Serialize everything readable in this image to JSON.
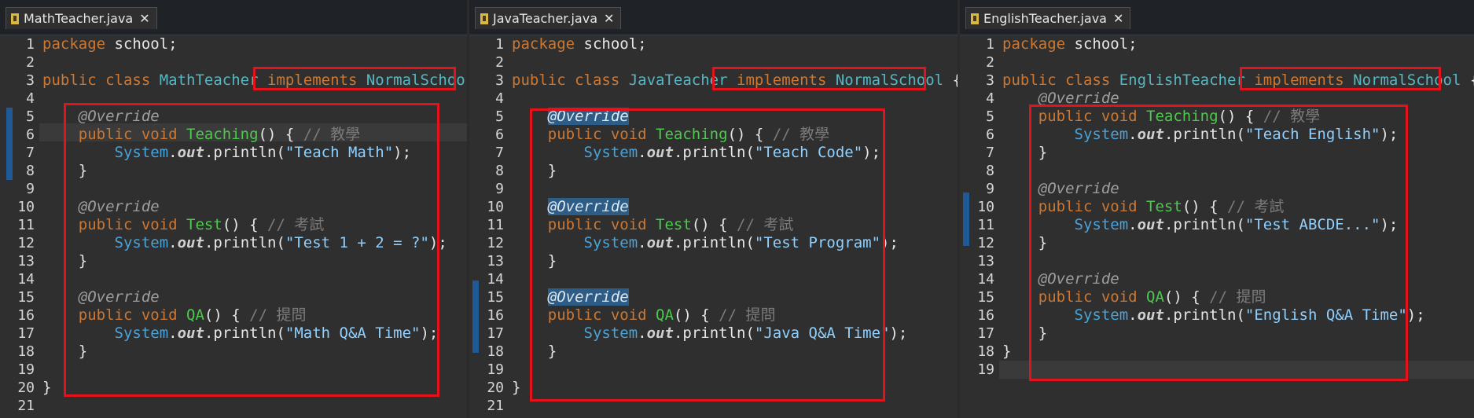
{
  "panels": [
    {
      "tab": "MathTeacher.java",
      "code": [
        {
          "n": "1",
          "s": [
            [
              "package",
              "kw"
            ],
            [
              " school;",
              ""
            ]
          ]
        },
        {
          "n": "2",
          "s": []
        },
        {
          "n": "3",
          "s": [
            [
              "public class ",
              "kw"
            ],
            [
              "MathTeacher",
              "cls"
            ],
            [
              " implements ",
              "kw"
            ],
            [
              "NormalSchoo",
              "cls"
            ]
          ]
        },
        {
          "n": "4",
          "s": []
        },
        {
          "n": "5",
          "s": [
            [
              "    ",
              ""
            ],
            [
              "@Override",
              "ann"
            ]
          ]
        },
        {
          "n": "6",
          "s": [
            [
              "    public void ",
              "kw"
            ],
            [
              "Teaching",
              "method"
            ],
            [
              "() { ",
              ""
            ],
            [
              "// 教學",
              "cmt"
            ]
          ]
        },
        {
          "n": "7",
          "s": [
            [
              "        ",
              ""
            ],
            [
              "System",
              "sys"
            ],
            [
              ".",
              ""
            ],
            [
              "out",
              "out"
            ],
            [
              ".println(",
              ""
            ],
            [
              "\"Teach Math\"",
              "str"
            ],
            [
              ");",
              ""
            ]
          ]
        },
        {
          "n": "8",
          "s": [
            [
              "    }",
              ""
            ]
          ]
        },
        {
          "n": "9",
          "s": []
        },
        {
          "n": "10",
          "s": [
            [
              "    ",
              ""
            ],
            [
              "@Override",
              "ann"
            ]
          ]
        },
        {
          "n": "11",
          "s": [
            [
              "    public void ",
              "kw"
            ],
            [
              "Test",
              "method"
            ],
            [
              "() { ",
              ""
            ],
            [
              "// 考試",
              "cmt"
            ]
          ]
        },
        {
          "n": "12",
          "s": [
            [
              "        ",
              ""
            ],
            [
              "System",
              "sys"
            ],
            [
              ".",
              ""
            ],
            [
              "out",
              "out"
            ],
            [
              ".println(",
              ""
            ],
            [
              "\"Test 1 + 2 = ?\"",
              "str"
            ],
            [
              ");",
              ""
            ]
          ]
        },
        {
          "n": "13",
          "s": [
            [
              "    }",
              ""
            ]
          ]
        },
        {
          "n": "14",
          "s": []
        },
        {
          "n": "15",
          "s": [
            [
              "    ",
              ""
            ],
            [
              "@Override",
              "ann"
            ]
          ]
        },
        {
          "n": "16",
          "s": [
            [
              "    public void ",
              "kw"
            ],
            [
              "QA",
              "method"
            ],
            [
              "() { ",
              ""
            ],
            [
              "// 提問",
              "cmt"
            ]
          ]
        },
        {
          "n": "17",
          "s": [
            [
              "        ",
              ""
            ],
            [
              "System",
              "sys"
            ],
            [
              ".",
              ""
            ],
            [
              "out",
              "out"
            ],
            [
              ".println(",
              ""
            ],
            [
              "\"Math Q&A Time\"",
              "str"
            ],
            [
              ");",
              ""
            ]
          ]
        },
        {
          "n": "18",
          "s": [
            [
              "    }",
              ""
            ]
          ]
        },
        {
          "n": "19",
          "s": []
        },
        {
          "n": "20",
          "s": [
            [
              "}",
              ""
            ]
          ]
        },
        {
          "n": "21",
          "s": []
        }
      ]
    },
    {
      "tab": "JavaTeacher.java",
      "code": [
        {
          "n": "1",
          "s": [
            [
              "package",
              "kw"
            ],
            [
              " school;",
              ""
            ]
          ]
        },
        {
          "n": "2",
          "s": []
        },
        {
          "n": "3",
          "s": [
            [
              "public class ",
              "kw"
            ],
            [
              "JavaTeacher",
              "cls"
            ],
            [
              " implements ",
              "kw"
            ],
            [
              "NormalSchool",
              "cls"
            ],
            [
              " {",
              ""
            ]
          ]
        },
        {
          "n": "4",
          "s": []
        },
        {
          "n": "5",
          "s": [
            [
              "    ",
              ""
            ],
            [
              "@Override",
              "ann hl"
            ]
          ]
        },
        {
          "n": "6",
          "s": [
            [
              "    public void ",
              "kw"
            ],
            [
              "Teaching",
              "method"
            ],
            [
              "() { ",
              ""
            ],
            [
              "// 教學",
              "cmt"
            ]
          ]
        },
        {
          "n": "7",
          "s": [
            [
              "        ",
              ""
            ],
            [
              "System",
              "sys"
            ],
            [
              ".",
              ""
            ],
            [
              "out",
              "out"
            ],
            [
              ".println(",
              ""
            ],
            [
              "\"Teach Code\"",
              "str"
            ],
            [
              ");",
              ""
            ]
          ]
        },
        {
          "n": "8",
          "s": [
            [
              "    }",
              ""
            ]
          ]
        },
        {
          "n": "9",
          "s": []
        },
        {
          "n": "10",
          "s": [
            [
              "    ",
              ""
            ],
            [
              "@Override",
              "ann hl"
            ]
          ]
        },
        {
          "n": "11",
          "s": [
            [
              "    public void ",
              "kw"
            ],
            [
              "Test",
              "method"
            ],
            [
              "() { ",
              ""
            ],
            [
              "// 考試",
              "cmt"
            ]
          ]
        },
        {
          "n": "12",
          "s": [
            [
              "        ",
              ""
            ],
            [
              "System",
              "sys"
            ],
            [
              ".",
              ""
            ],
            [
              "out",
              "out"
            ],
            [
              ".println(",
              ""
            ],
            [
              "\"Test Program\"",
              "str"
            ],
            [
              ");",
              ""
            ]
          ]
        },
        {
          "n": "13",
          "s": [
            [
              "    }",
              ""
            ]
          ]
        },
        {
          "n": "14",
          "s": []
        },
        {
          "n": "15",
          "s": [
            [
              "    ",
              ""
            ],
            [
              "@Override",
              "ann hl"
            ]
          ]
        },
        {
          "n": "16",
          "s": [
            [
              "    public void ",
              "kw"
            ],
            [
              "QA",
              "method"
            ],
            [
              "() { ",
              ""
            ],
            [
              "// 提問",
              "cmt"
            ]
          ]
        },
        {
          "n": "17",
          "s": [
            [
              "        ",
              ""
            ],
            [
              "System",
              "sys"
            ],
            [
              ".",
              ""
            ],
            [
              "out",
              "out"
            ],
            [
              ".println(",
              ""
            ],
            [
              "\"Java Q&A Time\"",
              "str"
            ],
            [
              ");",
              ""
            ]
          ]
        },
        {
          "n": "18",
          "s": [
            [
              "    }",
              ""
            ]
          ]
        },
        {
          "n": "19",
          "s": []
        },
        {
          "n": "20",
          "s": [
            [
              "}",
              ""
            ]
          ]
        },
        {
          "n": "21",
          "s": []
        }
      ]
    },
    {
      "tab": "EnglishTeacher.java",
      "code": [
        {
          "n": "1",
          "s": [
            [
              "package",
              "kw"
            ],
            [
              " school;",
              ""
            ]
          ]
        },
        {
          "n": "2",
          "s": []
        },
        {
          "n": "3",
          "s": [
            [
              "public class ",
              "kw"
            ],
            [
              "EnglishTeacher",
              "cls"
            ],
            [
              " implements ",
              "kw"
            ],
            [
              "NormalSchool",
              "cls"
            ],
            [
              " {",
              ""
            ]
          ]
        },
        {
          "n": "4",
          "s": [
            [
              "    ",
              ""
            ],
            [
              "@Override",
              "ann"
            ]
          ]
        },
        {
          "n": "5",
          "s": [
            [
              "    public void ",
              "kw"
            ],
            [
              "Teaching",
              "method"
            ],
            [
              "() { ",
              ""
            ],
            [
              "// 教學",
              "cmt"
            ]
          ]
        },
        {
          "n": "6",
          "s": [
            [
              "        ",
              ""
            ],
            [
              "System",
              "sys"
            ],
            [
              ".",
              ""
            ],
            [
              "out",
              "out"
            ],
            [
              ".println(",
              ""
            ],
            [
              "\"Teach English\"",
              "str"
            ],
            [
              ");",
              ""
            ]
          ]
        },
        {
          "n": "7",
          "s": [
            [
              "    }",
              ""
            ]
          ]
        },
        {
          "n": "8",
          "s": []
        },
        {
          "n": "9",
          "s": [
            [
              "    ",
              ""
            ],
            [
              "@Override",
              "ann"
            ]
          ]
        },
        {
          "n": "10",
          "s": [
            [
              "    public void ",
              "kw"
            ],
            [
              "Test",
              "method"
            ],
            [
              "() { ",
              ""
            ],
            [
              "// 考試",
              "cmt"
            ]
          ]
        },
        {
          "n": "11",
          "s": [
            [
              "        ",
              ""
            ],
            [
              "System",
              "sys"
            ],
            [
              ".",
              ""
            ],
            [
              "out",
              "out"
            ],
            [
              ".println(",
              ""
            ],
            [
              "\"Test ABCDE...\"",
              "str"
            ],
            [
              ");",
              ""
            ]
          ]
        },
        {
          "n": "12",
          "s": [
            [
              "    }",
              ""
            ]
          ]
        },
        {
          "n": "13",
          "s": []
        },
        {
          "n": "14",
          "s": [
            [
              "    ",
              ""
            ],
            [
              "@Override",
              "ann"
            ]
          ]
        },
        {
          "n": "15",
          "s": [
            [
              "    public void ",
              "kw"
            ],
            [
              "QA",
              "method"
            ],
            [
              "() { ",
              ""
            ],
            [
              "// 提問",
              "cmt"
            ]
          ]
        },
        {
          "n": "16",
          "s": [
            [
              "        ",
              ""
            ],
            [
              "System",
              "sys"
            ],
            [
              ".",
              ""
            ],
            [
              "out",
              "out"
            ],
            [
              ".println(",
              ""
            ],
            [
              "\"English Q&A Time\"",
              "str"
            ],
            [
              ");",
              ""
            ]
          ]
        },
        {
          "n": "17",
          "s": [
            [
              "    }",
              ""
            ]
          ]
        },
        {
          "n": "18",
          "s": [
            [
              "}",
              ""
            ]
          ]
        },
        {
          "n": "19",
          "s": []
        }
      ]
    }
  ]
}
